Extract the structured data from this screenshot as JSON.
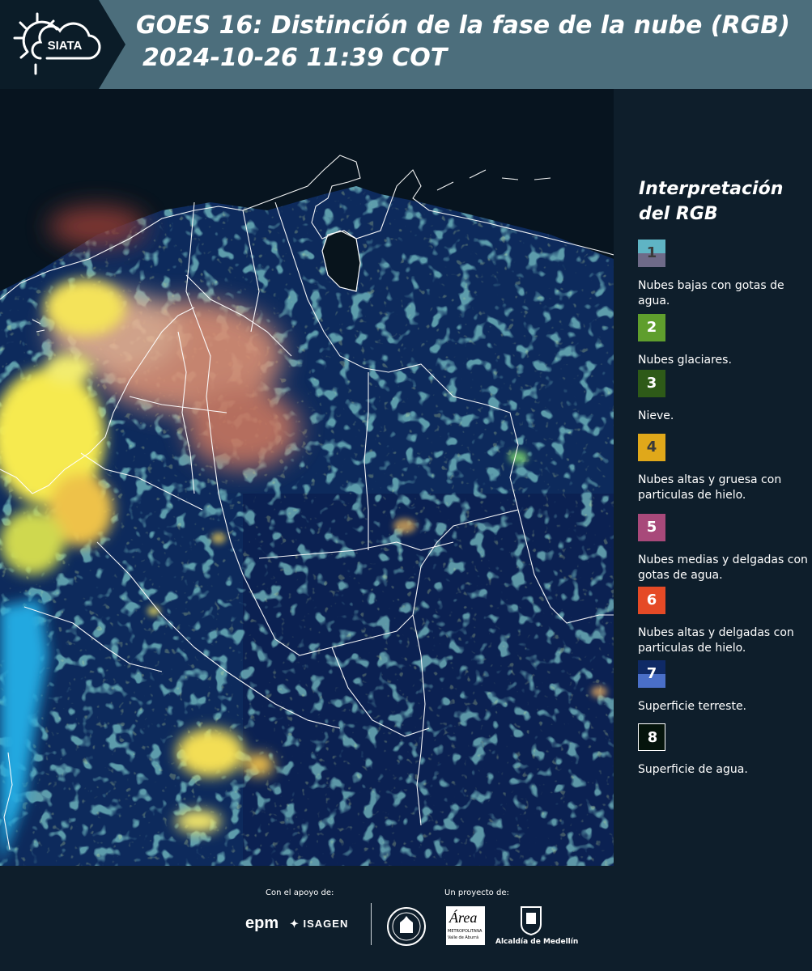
{
  "header": {
    "title_line1": "GOES 16: Distinción de la fase de la nube (RGB)",
    "title_line2": "2024-10-26 11:39 COT",
    "logo_text": "SIATA",
    "background_color": "#4c6e7c"
  },
  "legend": {
    "title": "Interpretación del RGB",
    "items": [
      {
        "number": "1",
        "label": "Nubes bajas con gotas de agua.",
        "color_top": "#5fb4c4",
        "color_bottom": "#6e6a88"
      },
      {
        "number": "2",
        "label": "Nubes glaciares.",
        "color_top": "#5f9e2d",
        "color_bottom": "#5f9e2d"
      },
      {
        "number": "3",
        "label": "Nieve.",
        "color_top": "#2e5a18",
        "color_bottom": "#2e5a18"
      },
      {
        "number": "4",
        "label": "Nubes altas y gruesa con particulas de hielo.",
        "color_top": "#e0a81a",
        "color_bottom": "#e0a81a"
      },
      {
        "number": "5",
        "label": "Nubes medias y delgadas con gotas de agua.",
        "color_top": "#a8497a",
        "color_bottom": "#a8497a"
      },
      {
        "number": "6",
        "label": "Nubes altas y delgadas con particulas de hielo.",
        "color_top": "#e54a26",
        "color_bottom": "#e54a26"
      },
      {
        "number": "7",
        "label": "Superficie terreste.",
        "color_top": "#0f2a66",
        "color_bottom": "#4a6fc8"
      },
      {
        "number": "8",
        "label": "Superficie de agua.",
        "color_top": "#05140c",
        "color_bottom": "#05140c"
      }
    ]
  },
  "footer": {
    "support_label": "Con el apoyo de:",
    "project_label": "Un proyecto de:",
    "sponsor_epm": "epm",
    "sponsor_isagen": "ISAGEN",
    "area_logo_text": "Área",
    "area_logo_subtext": "METROPOLITANA",
    "area_logo_subtext2": "Valle de Aburrá",
    "alcaldia_text": "Alcaldía de Medellín"
  }
}
